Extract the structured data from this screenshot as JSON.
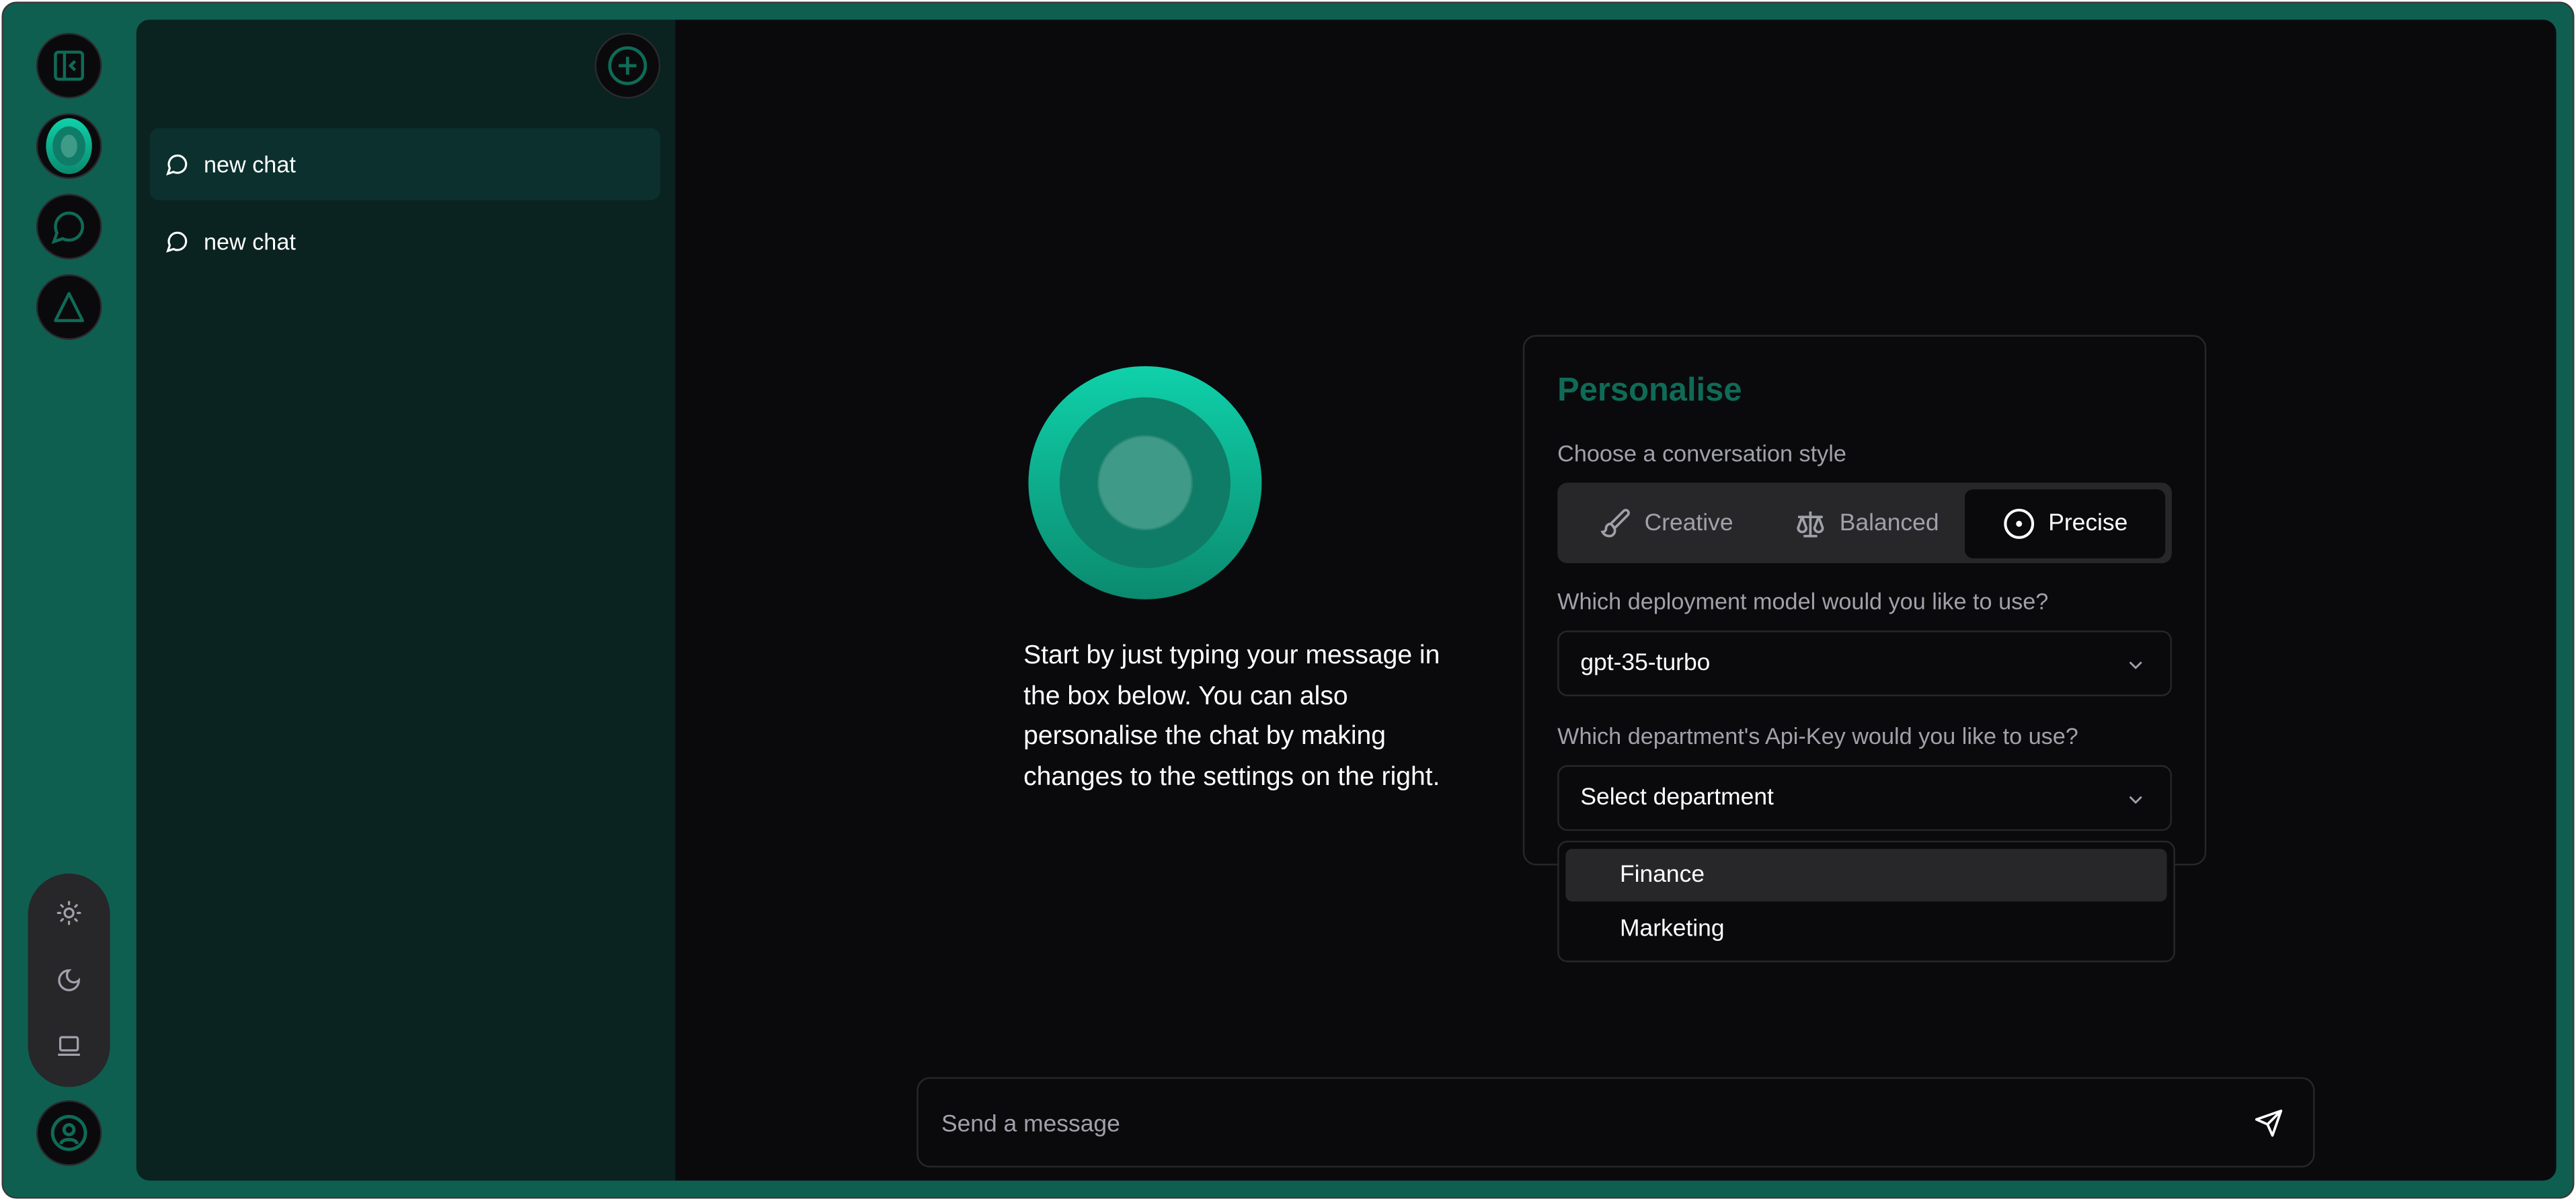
{
  "colors": {
    "frame": "#0f5f50",
    "sidebar": "#0a2220",
    "main": "#0a0a0c",
    "accent": "#0f6b57",
    "active_item": "#0b302d",
    "muted": "#a1a1aa",
    "surface": "#27272a"
  },
  "rail": {
    "icons": [
      "sidebar-collapse-icon",
      "logo-icon",
      "chat-icon",
      "triangle-icon"
    ],
    "theme_icons": [
      "sun-icon",
      "moon-icon",
      "laptop-icon"
    ],
    "profile_icon": "user-circle-icon"
  },
  "sidebar": {
    "new_chat_icon": "plus-circle-icon",
    "chats": [
      {
        "label": "new chat",
        "active": true
      },
      {
        "label": "new chat",
        "active": false
      }
    ]
  },
  "main": {
    "intro": "Start by just typing your message in the box below. You can also personalise the chat by making changes to the settings on the right."
  },
  "personalise": {
    "title": "Personalise",
    "style_label": "Choose a conversation style",
    "styles": [
      {
        "label": "Creative",
        "icon": "brush-icon"
      },
      {
        "label": "Balanced",
        "icon": "scale-icon"
      },
      {
        "label": "Precise",
        "icon": "target-icon",
        "selected": true
      }
    ],
    "model_label": "Which deployment model would you like to use?",
    "model_value": "gpt-35-turbo",
    "department_label": "Which department's Api-Key would you like to use?",
    "department_placeholder": "Select department",
    "department_options": [
      "Finance",
      "Marketing"
    ],
    "highlighted_option": "Finance"
  },
  "composer": {
    "placeholder": "Send a message",
    "send_icon": "send-icon"
  }
}
